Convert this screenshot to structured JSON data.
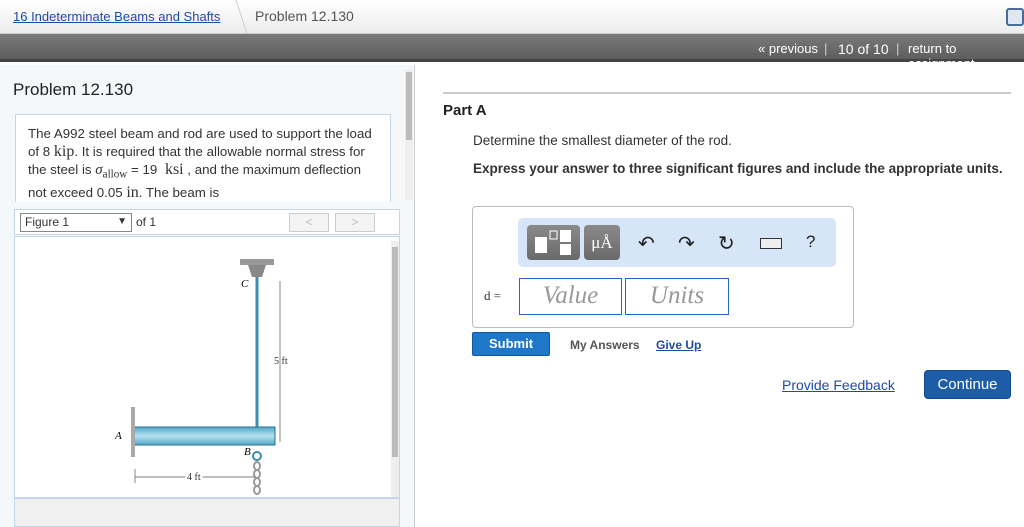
{
  "breadcrumb": {
    "chapter": "16 Indeterminate Beams and Shafts",
    "current": "Problem 12.130"
  },
  "nav": {
    "previous": "« previous",
    "position": "10 of 10",
    "return": "return to assignment"
  },
  "problem": {
    "title": "Problem 12.130",
    "text_parts": [
      "The A992 steel beam and rod are used to support the load of 8 ",
      "kip",
      ". It is required that the allowable normal stress for the steel is ",
      "σ",
      "allow",
      " = 19 ",
      "ksi",
      " , and the maximum deflection not exceed 0.05 ",
      "in",
      ". The beam is"
    ]
  },
  "figure": {
    "select": "Figure 1",
    "of": "of 1",
    "prev": "<",
    "next": ">",
    "labels": {
      "a": "A",
      "b": "B",
      "c": "C",
      "height": "5 ft",
      "length": "4 ft"
    }
  },
  "part": {
    "title": "Part A",
    "question": "Determine the smallest diameter of the rod.",
    "instruction": "Express your answer to three significant figures and include the appropriate units.",
    "toolbar": {
      "units": "μÅ",
      "help": "?"
    },
    "var": "d =",
    "value_placeholder": "Value",
    "units_placeholder": "Units",
    "submit": "Submit",
    "my_answers": "My Answers",
    "give_up": "Give Up"
  },
  "footer": {
    "feedback": "Provide Feedback",
    "continue": "Continue"
  }
}
